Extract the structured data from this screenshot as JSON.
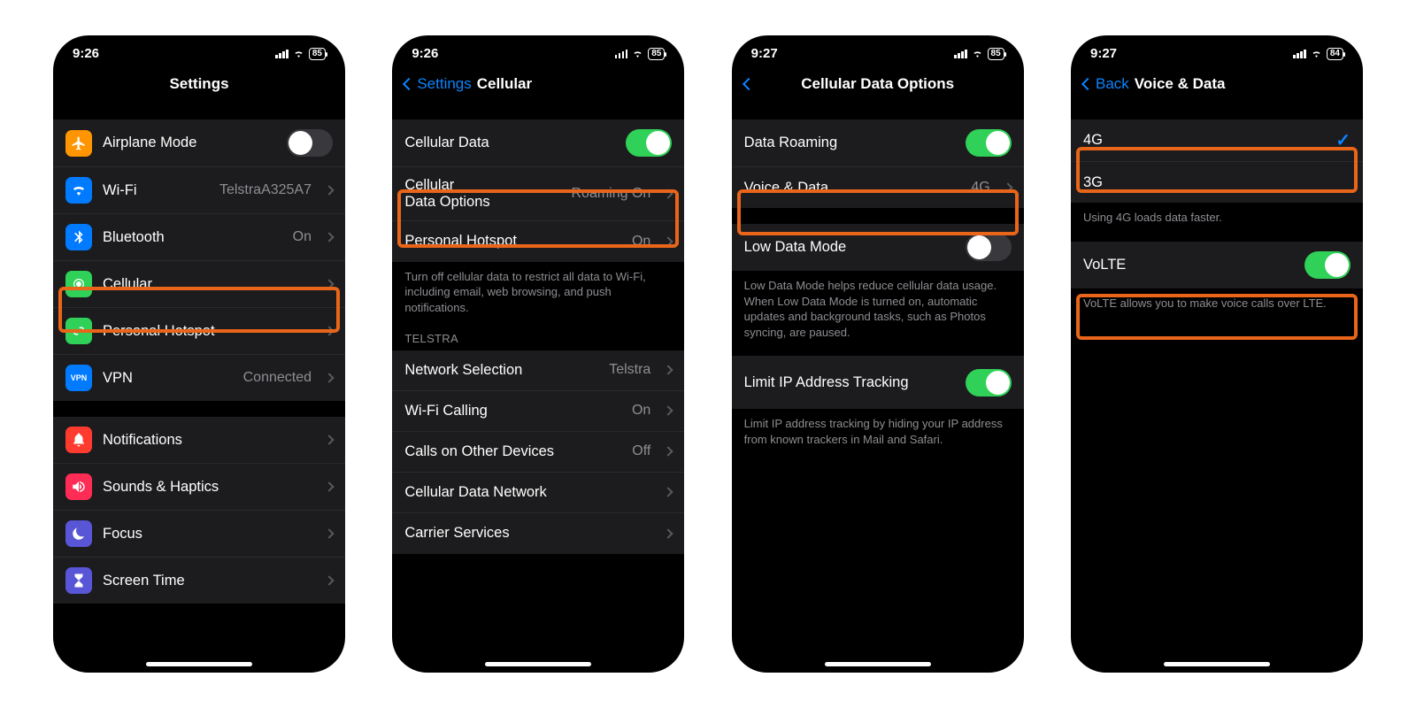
{
  "screen1": {
    "time": "9:26",
    "battery": "85",
    "title": "Settings",
    "rows": {
      "airplane": {
        "label": "Airplane Mode",
        "on": false,
        "icon_bg": "#ff9500"
      },
      "wifi": {
        "label": "Wi-Fi",
        "detail": "TelstraA325A7",
        "icon_bg": "#007aff"
      },
      "bluetooth": {
        "label": "Bluetooth",
        "detail": "On",
        "icon_bg": "#007aff"
      },
      "cellular": {
        "label": "Cellular",
        "icon_bg": "#30d158"
      },
      "hotspot": {
        "label": "Personal Hotspot",
        "icon_bg": "#30d158"
      },
      "vpn": {
        "label": "VPN",
        "detail": "Connected",
        "icon_bg": "#007aff",
        "icon_text": "VPN"
      },
      "notifications": {
        "label": "Notifications",
        "icon_bg": "#ff3b30"
      },
      "sounds": {
        "label": "Sounds & Haptics",
        "icon_bg": "#ff2d55"
      },
      "focus": {
        "label": "Focus",
        "icon_bg": "#5856d6"
      },
      "screentime": {
        "label": "Screen Time",
        "icon_bg": "#5856d6"
      }
    }
  },
  "screen2": {
    "time": "9:26",
    "battery": "85",
    "back": "Settings",
    "title": "Cellular",
    "rows": {
      "cellular_data": {
        "label": "Cellular Data",
        "on": true
      },
      "data_options": {
        "label": "Cellular\nData Options",
        "detail": "Roaming On"
      },
      "hotspot": {
        "label": "Personal Hotspot",
        "detail": "On"
      }
    },
    "footer1": "Turn off cellular data to restrict all data to Wi-Fi, including email, web browsing, and push notifications.",
    "section_header": "TELSTRA",
    "rows2": {
      "network": {
        "label": "Network Selection",
        "detail": "Telstra"
      },
      "wifi_calling": {
        "label": "Wi-Fi Calling",
        "detail": "On"
      },
      "other_devices": {
        "label": "Calls on Other Devices",
        "detail": "Off"
      },
      "data_network": {
        "label": "Cellular Data Network"
      },
      "carrier": {
        "label": "Carrier Services"
      }
    }
  },
  "screen3": {
    "time": "9:27",
    "battery": "85",
    "title": "Cellular Data Options",
    "rows": {
      "roaming": {
        "label": "Data Roaming",
        "on": true
      },
      "voice_data": {
        "label": "Voice & Data",
        "detail": "4G"
      },
      "low_data": {
        "label": "Low Data Mode",
        "on": false
      },
      "limit_ip": {
        "label": "Limit IP Address Tracking",
        "on": true
      }
    },
    "footer_low": "Low Data Mode helps reduce cellular data usage. When Low Data Mode is turned on, automatic updates and background tasks, such as Photos syncing, are paused.",
    "footer_ip": "Limit IP address tracking by hiding your IP address from known trackers in Mail and Safari."
  },
  "screen4": {
    "time": "9:27",
    "battery": "84",
    "back": "Back",
    "title": "Voice & Data",
    "rows": {
      "fourg": {
        "label": "4G",
        "selected": true
      },
      "threeg": {
        "label": "3G",
        "selected": false
      }
    },
    "footer1": "Using 4G loads data faster.",
    "volte": {
      "label": "VoLTE",
      "on": true
    },
    "footer2": "VoLTE allows you to make voice calls over LTE."
  }
}
